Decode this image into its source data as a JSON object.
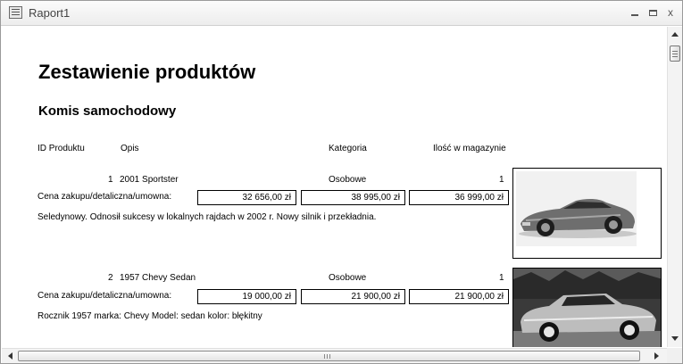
{
  "window": {
    "title": "Raport1"
  },
  "report": {
    "title": "Zestawienie produktów",
    "subtitle": "Komis samochodowy",
    "headers": {
      "id": "ID Produktu",
      "opis": "Opis",
      "kategoria": "Kategoria",
      "ilosc": "Ilość w magazynie"
    },
    "price_label": "Cena zakupu/detaliczna/umowna:",
    "records": [
      {
        "id": "1",
        "opis": "2001 Sportster",
        "kategoria": "Osobowe",
        "ilosc": "1",
        "prices": [
          "32 656,00 zł",
          "38 995,00 zł",
          "36 999,00 zł"
        ],
        "description": "Seledynowy. Odnosił sukcesy w lokalnych rajdach w 2002 r. Nowy silnik i przekładnia.",
        "photo": "silver-sports-convertible"
      },
      {
        "id": "2",
        "opis": "1957 Chevy Sedan",
        "kategoria": "Osobowe",
        "ilosc": "1",
        "prices": [
          "19 000,00 zł",
          "21 900,00 zł",
          "21 900,00 zł"
        ],
        "description": "Rocznik 1957 marka: Chevy Model: sedan kolor: błękitny",
        "photo": "classic-1957-sedan"
      }
    ]
  },
  "icons": {
    "window": "report-icon",
    "minimize": "minimize-icon",
    "maximize": "maximize-icon",
    "close": "close-icon",
    "close_glyph": "x"
  },
  "colors": {
    "chrome": "#f3f3f3",
    "text": "#000000",
    "title_text": "#444444"
  }
}
